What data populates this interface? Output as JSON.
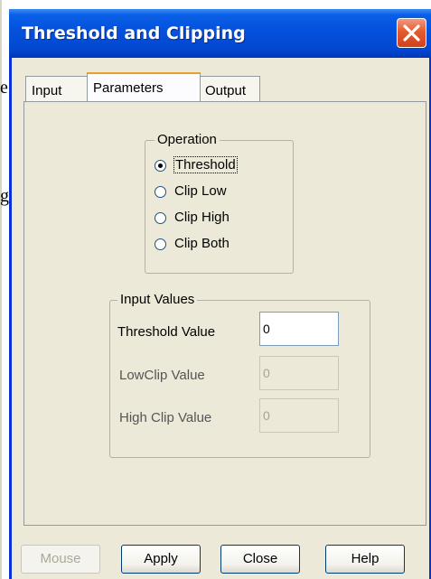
{
  "background": {
    "glyph_1": "e",
    "glyph_2": "g"
  },
  "window": {
    "title": "Threshold and Clipping"
  },
  "tabs": [
    {
      "label": "Input",
      "active": false
    },
    {
      "label": "Parameters",
      "active": true
    },
    {
      "label": "Output",
      "active": false
    }
  ],
  "operation": {
    "legend": "Operation",
    "options": [
      {
        "label": "Threshold",
        "selected": true
      },
      {
        "label": "Clip Low",
        "selected": false
      },
      {
        "label": "Clip High",
        "selected": false
      },
      {
        "label": "Clip Both",
        "selected": false
      }
    ]
  },
  "input_values": {
    "legend": "Input Values",
    "threshold": {
      "label": "Threshold Value",
      "value": "0",
      "enabled": true
    },
    "low_clip": {
      "label": "LowClip Value",
      "value": "0",
      "enabled": false
    },
    "high_clip": {
      "label": "High Clip Value",
      "value": "0",
      "enabled": false
    }
  },
  "buttons": {
    "mouse": "Mouse",
    "apply": "Apply",
    "close": "Close",
    "help": "Help"
  },
  "colors": {
    "titlebar": "#0453de",
    "dialog_bg": "#ece9d8",
    "active_tab_accent": "#e6a12b"
  },
  "icons": {
    "close": "close-x-icon"
  }
}
